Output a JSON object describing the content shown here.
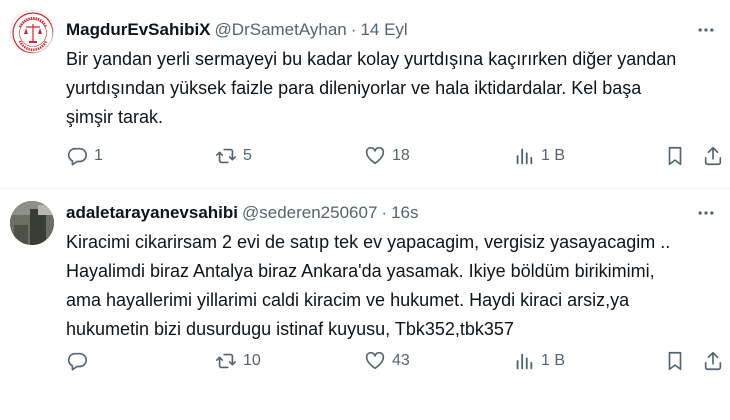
{
  "tweets": [
    {
      "name": "MagdurEvSahibiX",
      "handle": "@DrSametAyhan",
      "separator": "·",
      "time": "14 Eyl",
      "avatar_text": "EVSAHİPLERİ ADALET ARIYOR",
      "lines": [
        "Bir yandan yerli sermayeyi bu kadar kolay yurtdışına kaçırırken diğer yandan",
        "yurtdışından yüksek faizle para dileniyorlar ve  hala iktidardalar. Kel başa",
        "şimşir tarak."
      ],
      "replies": "1",
      "retweets": "5",
      "likes": "18",
      "views": "1 B"
    },
    {
      "name": "adaletarayanevsahibi",
      "handle": "@sederen250607",
      "separator": "·",
      "time": "16s",
      "lines": [
        "Kiracimi cikarirsam 2 evi de satıp tek ev yapacagim, vergisiz yasayacagim ..",
        "Hayalimdi biraz Antalya biraz Ankara'da yasamak. Ikiye böldüm birikimimi,",
        "ama hayallerimi yillarimi caldi kiracim ve hukumet. Haydi kiraci arsiz,ya",
        "hukumetin bizi dusurdugu istinaf kuyusu, Tbk352,tbk357"
      ],
      "replies": "",
      "retweets": "10",
      "likes": "43",
      "views": "1 B"
    }
  ],
  "icons": {
    "reply": "reply-icon",
    "retweet": "retweet-icon",
    "like": "like-icon",
    "views": "views-icon",
    "bookmark": "bookmark-icon",
    "share": "share-icon",
    "more": "more-icon"
  },
  "colors": {
    "text": "#0f1419",
    "secondary": "#536471",
    "divider": "#eff3f4",
    "logo_red": "#d3262c"
  }
}
